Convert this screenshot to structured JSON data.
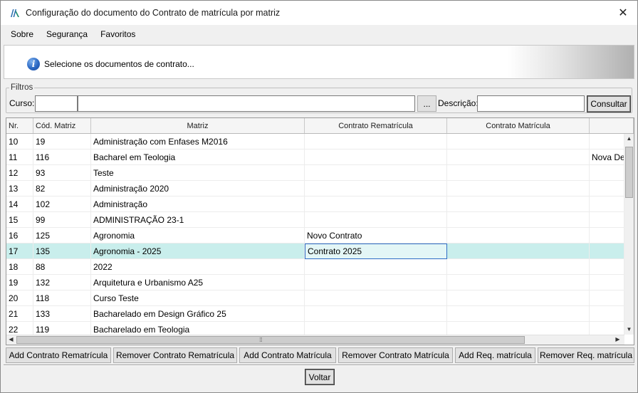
{
  "window": {
    "title": "Configuração do documento do Contrato de matrícula por matriz",
    "close_glyph": "✕",
    "logo_icon": "app-logo-icon"
  },
  "menu": {
    "items": [
      "Sobre",
      "Segurança",
      "Favoritos"
    ]
  },
  "banner": {
    "icon": "info-icon",
    "icon_glyph": "i",
    "message": "Selecione os documentos de contrato..."
  },
  "filters": {
    "legend": "Filtros",
    "curso_label": "Curso:",
    "curso_code_value": "",
    "curso_name_value": "",
    "lookup_label": "...",
    "descricao_label": "Descrição:",
    "descricao_value": "",
    "consultar_label": "Consultar"
  },
  "grid": {
    "columns": [
      "Nr.",
      "Cód. Matriz",
      "Matriz",
      "Contrato Rematrícula",
      "Contrato Matrícula",
      ""
    ],
    "rows": [
      {
        "nr": "10",
        "cod": "19",
        "matriz": "Administração com Enfases M2016",
        "remat": "",
        "matric": "",
        "extra": ""
      },
      {
        "nr": "11",
        "cod": "116",
        "matriz": "Bacharel em Teologia",
        "remat": "",
        "matric": "",
        "extra": "Nova Dec"
      },
      {
        "nr": "12",
        "cod": "93",
        "matriz": "Teste",
        "remat": "",
        "matric": "",
        "extra": ""
      },
      {
        "nr": "13",
        "cod": "82",
        "matriz": "Administração 2020",
        "remat": "",
        "matric": "",
        "extra": ""
      },
      {
        "nr": "14",
        "cod": "102",
        "matriz": "Administração",
        "remat": "",
        "matric": "",
        "extra": ""
      },
      {
        "nr": "15",
        "cod": "99",
        "matriz": "ADMINISTRAÇÃO 23-1",
        "remat": "",
        "matric": "",
        "extra": ""
      },
      {
        "nr": "16",
        "cod": "125",
        "matriz": "Agronomia",
        "remat": "Novo Contrato",
        "matric": "",
        "extra": ""
      },
      {
        "nr": "17",
        "cod": "135",
        "matriz": "Agronomia - 2025",
        "remat": "Contrato 2025",
        "matric": "",
        "extra": ""
      },
      {
        "nr": "18",
        "cod": "88",
        "matriz": "2022",
        "remat": "",
        "matric": "",
        "extra": ""
      },
      {
        "nr": "19",
        "cod": "132",
        "matriz": "Arquitetura e Urbanismo A25",
        "remat": "",
        "matric": "",
        "extra": ""
      },
      {
        "nr": "20",
        "cod": "118",
        "matriz": "Curso Teste",
        "remat": "",
        "matric": "",
        "extra": ""
      },
      {
        "nr": "21",
        "cod": "133",
        "matriz": "Bacharelado em Design Gráfico 25",
        "remat": "",
        "matric": "",
        "extra": ""
      },
      {
        "nr": "22",
        "cod": "119",
        "matriz": "Bacharelado em Teologia",
        "remat": "",
        "matric": "",
        "extra": ""
      }
    ],
    "selected_row": "17",
    "scroll_arrows": {
      "up": "▲",
      "down": "▼",
      "left": "◀",
      "right": "▶"
    },
    "grip_glyph": "⁞⁞⁞"
  },
  "actions": {
    "add_rematricula": "Add Contrato Rematrícula",
    "remove_rematricula": "Remover Contrato Rematrícula",
    "add_matricula": "Add Contrato Matrícula",
    "remove_matricula": "Remover Contrato Matrícula",
    "add_req": "Add Req. matrícula",
    "remove_req": "Remover Req. matrícula",
    "voltar": "Voltar"
  }
}
